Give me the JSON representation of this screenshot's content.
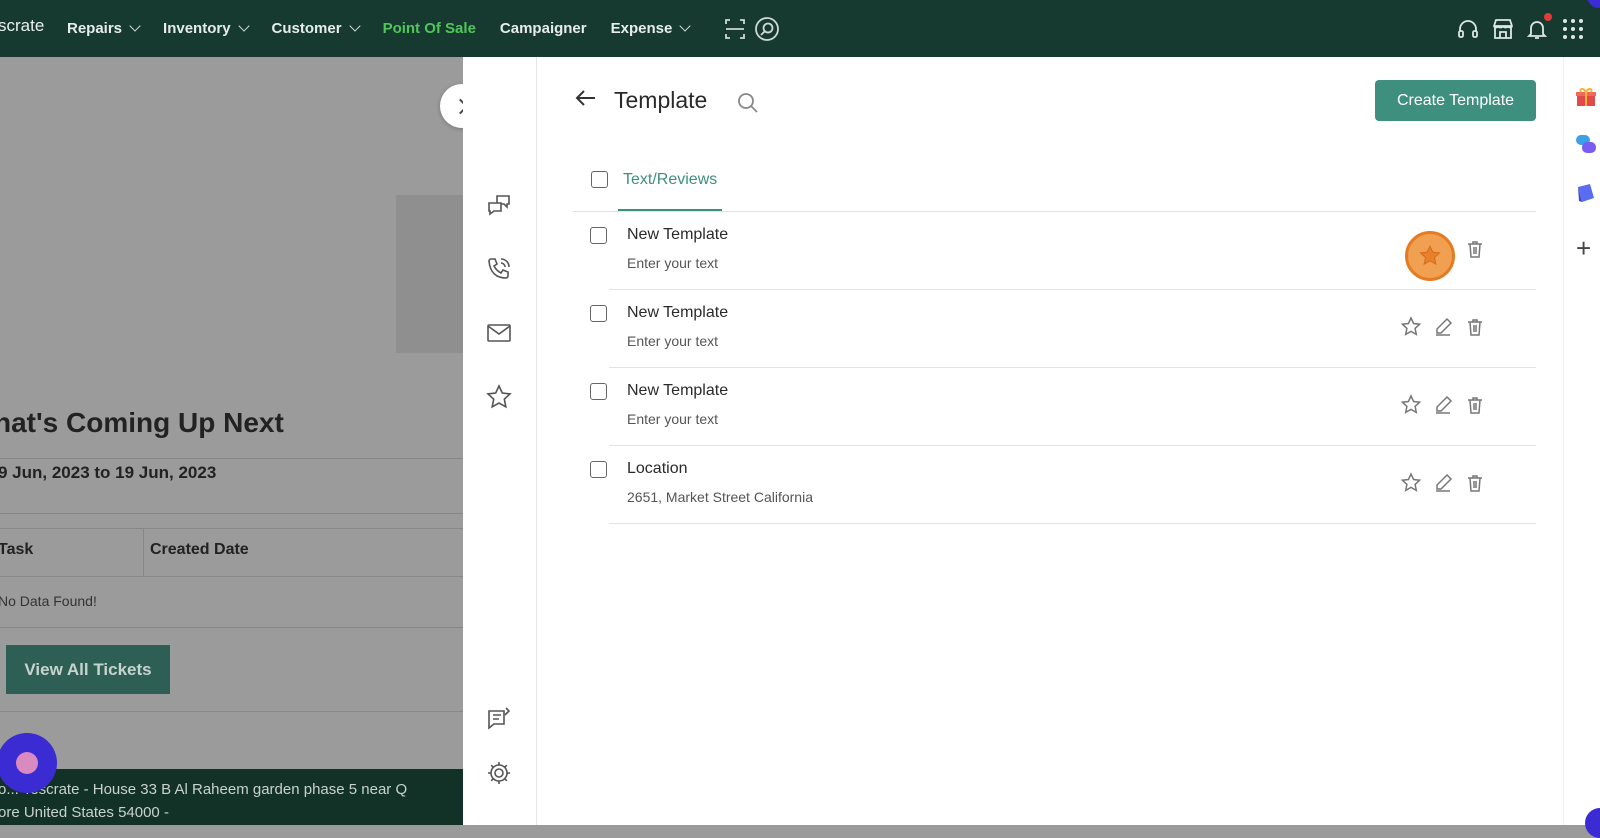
{
  "topnav": {
    "brand": "scrate",
    "items": [
      {
        "label": "Repairs",
        "dropdown": true
      },
      {
        "label": "Inventory",
        "dropdown": true
      },
      {
        "label": "Customer",
        "dropdown": true
      },
      {
        "label": "Point Of Sale",
        "dropdown": false
      },
      {
        "label": "Campaigner",
        "dropdown": false
      },
      {
        "label": "Expense",
        "dropdown": true
      }
    ],
    "active_color": "#4fc65a"
  },
  "background": {
    "heading": "hat's Coming Up Next",
    "date_range": "9 Jun, 2023 to 19 Jun, 2023",
    "columns": [
      "Task",
      "Created Date"
    ],
    "empty": "No Data Found!",
    "view_all": "View All Tickets",
    "footer_line1": "o... Tescrate - House 33 B Al Raheem garden phase 5 near Q",
    "footer_line2": "ore United States 54000 -"
  },
  "panel": {
    "title": "Template",
    "create_label": "Create Template",
    "tab_label": "Text/Reviews",
    "accent": "#3f8f7e",
    "templates": [
      {
        "title": "New Template",
        "subtitle": "Enter your text"
      },
      {
        "title": "New Template",
        "subtitle": "Enter your text"
      },
      {
        "title": "New Template",
        "subtitle": "Enter your text"
      },
      {
        "title": "Location",
        "subtitle": "2651, Market Street California"
      }
    ]
  }
}
